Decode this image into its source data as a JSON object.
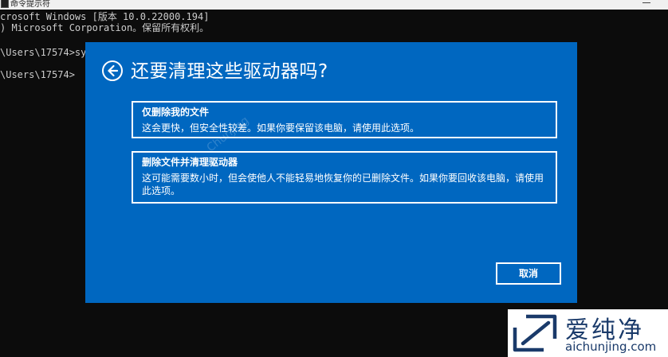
{
  "console": {
    "window_title": "命令提示符",
    "lines": [
      "crosoft Windows [版本 10.0.22000.194]",
      ") Microsoft Corporation。保留所有权利。",
      "\\Users\\17574>sy",
      "\\Users\\17574>"
    ]
  },
  "dialog": {
    "title": "还要清理这些驱动器吗?",
    "options": [
      {
        "title": "仅删除我的文件",
        "description": "这会更快，但安全性较差。如果你要保留该电脑，请使用此选项。"
      },
      {
        "title": "删除文件并清理驱动器",
        "description": "这可能需要数小时，但会使他人不能轻易地恢复你的已删除文件。如果你要回收该电脑，请使用此选项。"
      }
    ],
    "cancel_label": "取消",
    "back_icon": "back-arrow-icon",
    "accent_color": "#0067c0"
  },
  "watermark": {
    "faint_text": "ChunJing",
    "logo_name": "爱纯净",
    "logo_url": "aichunjing.com",
    "logo_color": "#1a3a6a"
  }
}
